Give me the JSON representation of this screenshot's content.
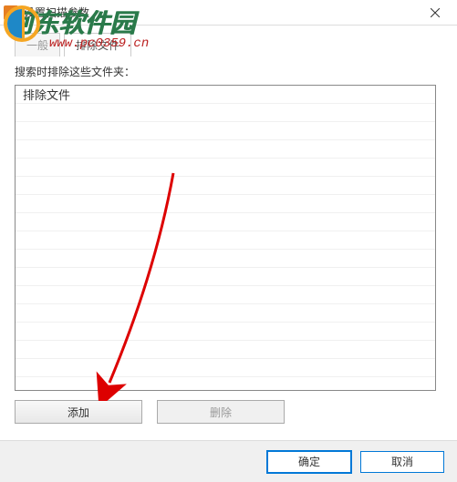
{
  "window": {
    "title": "设置扫描参数"
  },
  "watermark": {
    "brand": "河东软件园",
    "url": "www.pc0359.cn"
  },
  "tabs": {
    "general": "一般",
    "exclude": "排除文件"
  },
  "content": {
    "label": "搜索时排除这些文件夹：",
    "list_items": [
      "排除文件"
    ]
  },
  "buttons": {
    "add": "添加",
    "delete": "删除",
    "ok": "确定",
    "cancel": "取消"
  }
}
